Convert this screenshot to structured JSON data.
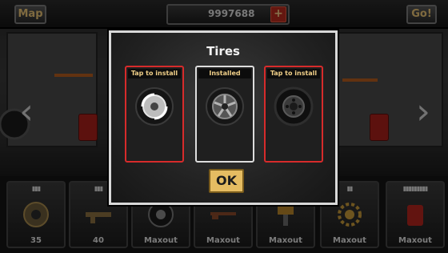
{
  "topbar": {
    "map_label": "Map",
    "money": "9997688",
    "plus_label": "+",
    "go_label": "Go!"
  },
  "nav": {
    "left_arrow": "‹",
    "right_arrow": "›"
  },
  "slots": [
    {
      "bars": "▮▮▮",
      "label": "35",
      "icon": "brake-disc-icon"
    },
    {
      "bars": "▮▮▮",
      "label": "40",
      "icon": "gun-icon"
    },
    {
      "bars": "",
      "label": "Maxout",
      "icon": "tire-icon"
    },
    {
      "bars": "",
      "label": "Maxout",
      "icon": "shotgun-icon"
    },
    {
      "bars": "",
      "label": "Maxout",
      "icon": "drill-icon"
    },
    {
      "bars": "▮▮",
      "label": "Maxout",
      "icon": "gear-icon"
    },
    {
      "bars": "▮▮▮▮▮▮▮▮▮",
      "label": "Maxout",
      "icon": "fuel-can-icon"
    }
  ],
  "modal": {
    "title": "Tires",
    "cards": [
      {
        "label": "Tap to install",
        "state": "uninstalled",
        "icon": "spoked-tire-icon"
      },
      {
        "label": "Installed",
        "state": "installed",
        "icon": "alloy-tire-icon"
      },
      {
        "label": "Tap to install",
        "state": "uninstalled",
        "icon": "offroad-tire-icon"
      }
    ],
    "ok_label": "OK"
  },
  "colors": {
    "accent": "#e5bc62",
    "red": "#d72b2b",
    "gold_text": "#f1d089"
  }
}
